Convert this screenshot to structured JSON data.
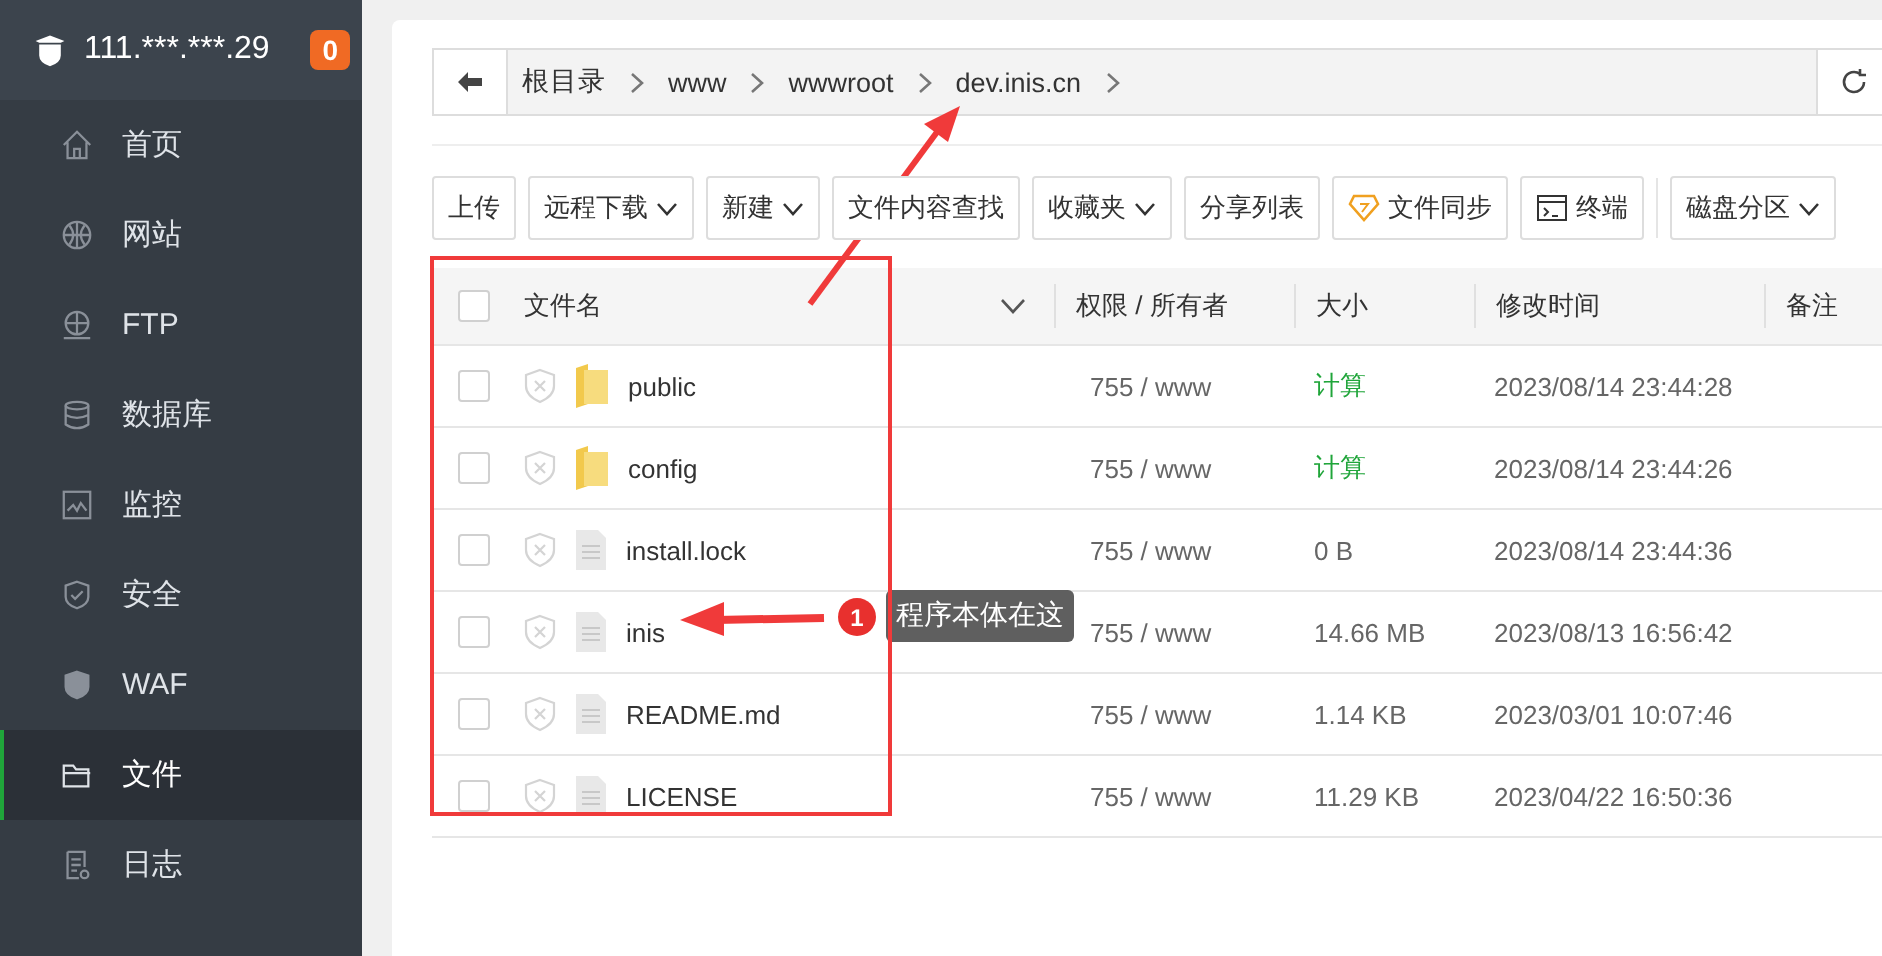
{
  "server": {
    "address": "111.***.***.29",
    "alerts": "0"
  },
  "sidebar": {
    "items": [
      {
        "label": "首页",
        "selected": false
      },
      {
        "label": "网站",
        "selected": false
      },
      {
        "label": "FTP",
        "selected": false
      },
      {
        "label": "数据库",
        "selected": false
      },
      {
        "label": "监控",
        "selected": false
      },
      {
        "label": "安全",
        "selected": false
      },
      {
        "label": "WAF",
        "selected": false
      },
      {
        "label": "文件",
        "selected": true
      },
      {
        "label": "日志",
        "selected": false
      }
    ]
  },
  "breadcrumb": [
    "根目录",
    "www",
    "wwwroot",
    "dev.inis.cn"
  ],
  "toolbar": [
    {
      "label": "上传",
      "kind": "plain"
    },
    {
      "label": "远程下载",
      "kind": "dropdown"
    },
    {
      "label": "新建",
      "kind": "dropdown"
    },
    {
      "label": "文件内容查找",
      "kind": "plain"
    },
    {
      "label": "收藏夹",
      "kind": "dropdown"
    },
    {
      "label": "分享列表",
      "kind": "plain"
    },
    {
      "label": "文件同步",
      "kind": "sync"
    },
    {
      "label": "终端",
      "kind": "terminal"
    },
    {
      "label": "磁盘分区",
      "kind": "dropdown",
      "separated": true
    }
  ],
  "table": {
    "columns": [
      "文件名",
      "权限 / 所有者",
      "大小",
      "修改时间",
      "备注"
    ],
    "all_checked": false,
    "rows": [
      {
        "name": "public",
        "kind": "folder",
        "checked": false,
        "permission": "755 / www",
        "size": "计算",
        "size_link": true,
        "modified": "2023/08/14 23:44:28"
      },
      {
        "name": "config",
        "kind": "folder",
        "checked": false,
        "permission": "755 / www",
        "size": "计算",
        "size_link": true,
        "modified": "2023/08/14 23:44:26"
      },
      {
        "name": "install.lock",
        "kind": "file",
        "checked": false,
        "permission": "755 / www",
        "size": "0 B",
        "size_link": false,
        "modified": "2023/08/14 23:44:36"
      },
      {
        "name": "inis",
        "kind": "file",
        "checked": false,
        "permission": "755 / www",
        "size": "14.66 MB",
        "size_link": false,
        "modified": "2023/08/13 16:56:42"
      },
      {
        "name": "README.md",
        "kind": "file",
        "checked": false,
        "permission": "755 / www",
        "size": "1.14 KB",
        "size_link": false,
        "modified": "2023/03/01 10:07:46"
      },
      {
        "name": "LICENSE",
        "kind": "file",
        "checked": false,
        "permission": "755 / www",
        "size": "11.29 KB",
        "size_link": false,
        "modified": "2023/04/22 16:50:36"
      }
    ]
  },
  "annotation": {
    "badge": "1",
    "note": "程序本体在这"
  }
}
